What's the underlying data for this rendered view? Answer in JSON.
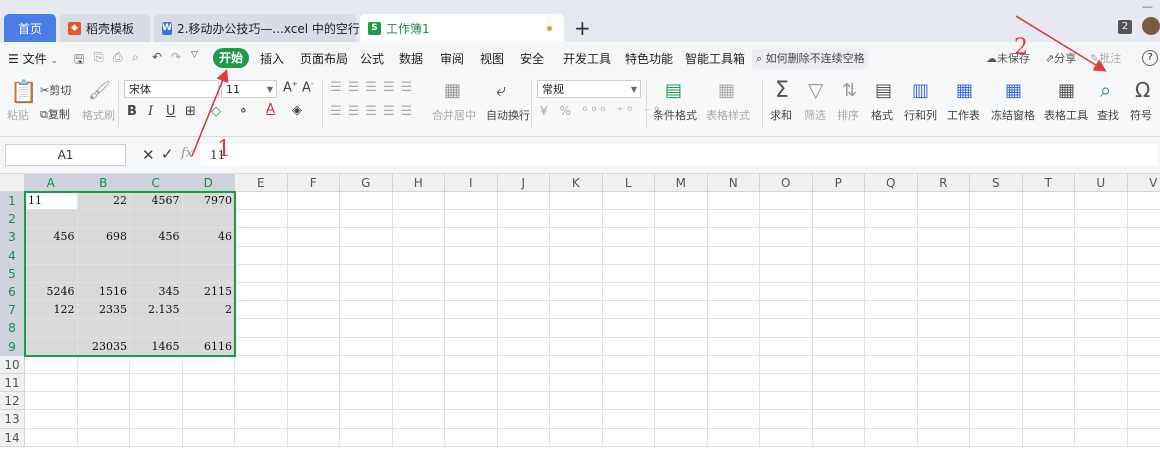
{
  "tabs": {
    "home": "首页",
    "daoke": "稻壳模板",
    "doc": "2.移动办公技巧—...xcel 中的空行",
    "book": "工作簿1",
    "badge": "2",
    "new_tab": "+"
  },
  "menu": {
    "file": "文件",
    "items": [
      "开始",
      "插入",
      "页面布局",
      "公式",
      "数据",
      "审阅",
      "视图",
      "安全",
      "开发工具",
      "特色功能",
      "智能工具箱"
    ],
    "search": "如何删除不连续空格",
    "unsaved": "未保存",
    "share": "分享",
    "comment": "批注"
  },
  "ribbon": {
    "paste": "粘贴",
    "cut": "剪切",
    "copy": "复制",
    "format_painter": "格式刷",
    "font_name": "宋体",
    "font_size": "11",
    "bold": "B",
    "italic": "I",
    "underline": "U",
    "merge": "合并居中",
    "wrap": "自动换行",
    "number_format": "常规",
    "cond_format": "条件格式",
    "table_style": "表格样式",
    "sum": "求和",
    "filter": "筛选",
    "sort": "排序",
    "format": "格式",
    "rowcol": "行和列",
    "sheet": "工作表",
    "freeze": "冻结窗格",
    "table_tools": "表格工具",
    "find": "查找",
    "symbol": "符号"
  },
  "formula_bar": {
    "name_box": "A1",
    "fx": "fx",
    "value": "11"
  },
  "grid": {
    "columns": [
      "A",
      "B",
      "C",
      "D",
      "E",
      "F",
      "G",
      "H",
      "I",
      "J",
      "K",
      "L",
      "M",
      "N",
      "O",
      "P",
      "Q",
      "R",
      "S",
      "T",
      "U",
      "V"
    ],
    "rows": [
      "1",
      "2",
      "3",
      "4",
      "5",
      "6",
      "7",
      "8",
      "9",
      "10",
      "11",
      "12",
      "13",
      "14"
    ],
    "cells": {
      "r1": [
        "11",
        "22",
        "4567",
        "7970"
      ],
      "r2": [
        "",
        "",
        "",
        ""
      ],
      "r3": [
        "456",
        "698",
        "456",
        "46"
      ],
      "r4": [
        "",
        "",
        "",
        ""
      ],
      "r5": [
        "",
        "",
        "",
        ""
      ],
      "r6": [
        "5246",
        "1516",
        "345",
        "2115"
      ],
      "r7": [
        "122",
        "2335",
        "2.135",
        "2"
      ],
      "r8": [
        "",
        "",
        "",
        ""
      ],
      "r9": [
        "",
        "23035",
        "1465",
        "6116"
      ]
    }
  },
  "annotations": {
    "label1": "1",
    "label2": "2",
    "color": "#e23a3a"
  },
  "colors": {
    "accent": "#1e9b49",
    "home_tab": "#4a7de6",
    "selection": "#d9d9d9"
  }
}
